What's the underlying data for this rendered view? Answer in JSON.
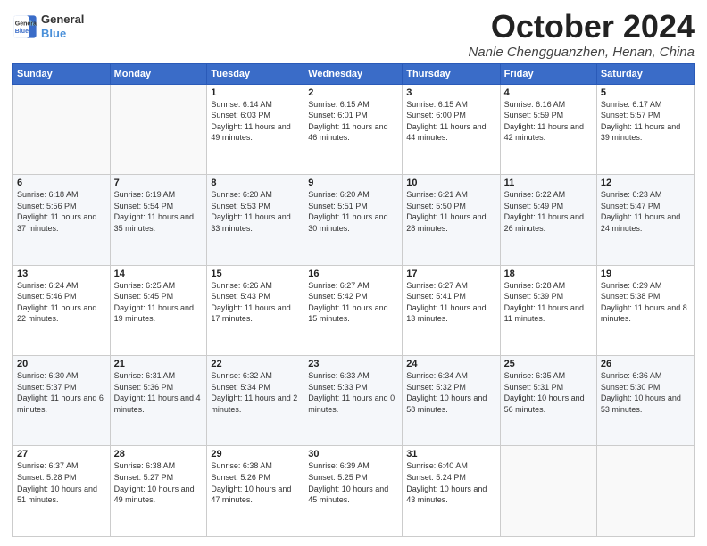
{
  "logo": {
    "line1": "General",
    "line2": "Blue"
  },
  "header": {
    "month": "October 2024",
    "location": "Nanle Chengguanzhen, Henan, China"
  },
  "weekdays": [
    "Sunday",
    "Monday",
    "Tuesday",
    "Wednesday",
    "Thursday",
    "Friday",
    "Saturday"
  ],
  "weeks": [
    [
      {
        "day": "",
        "info": ""
      },
      {
        "day": "",
        "info": ""
      },
      {
        "day": "1",
        "info": "Sunrise: 6:14 AM\nSunset: 6:03 PM\nDaylight: 11 hours and 49 minutes."
      },
      {
        "day": "2",
        "info": "Sunrise: 6:15 AM\nSunset: 6:01 PM\nDaylight: 11 hours and 46 minutes."
      },
      {
        "day": "3",
        "info": "Sunrise: 6:15 AM\nSunset: 6:00 PM\nDaylight: 11 hours and 44 minutes."
      },
      {
        "day": "4",
        "info": "Sunrise: 6:16 AM\nSunset: 5:59 PM\nDaylight: 11 hours and 42 minutes."
      },
      {
        "day": "5",
        "info": "Sunrise: 6:17 AM\nSunset: 5:57 PM\nDaylight: 11 hours and 39 minutes."
      }
    ],
    [
      {
        "day": "6",
        "info": "Sunrise: 6:18 AM\nSunset: 5:56 PM\nDaylight: 11 hours and 37 minutes."
      },
      {
        "day": "7",
        "info": "Sunrise: 6:19 AM\nSunset: 5:54 PM\nDaylight: 11 hours and 35 minutes."
      },
      {
        "day": "8",
        "info": "Sunrise: 6:20 AM\nSunset: 5:53 PM\nDaylight: 11 hours and 33 minutes."
      },
      {
        "day": "9",
        "info": "Sunrise: 6:20 AM\nSunset: 5:51 PM\nDaylight: 11 hours and 30 minutes."
      },
      {
        "day": "10",
        "info": "Sunrise: 6:21 AM\nSunset: 5:50 PM\nDaylight: 11 hours and 28 minutes."
      },
      {
        "day": "11",
        "info": "Sunrise: 6:22 AM\nSunset: 5:49 PM\nDaylight: 11 hours and 26 minutes."
      },
      {
        "day": "12",
        "info": "Sunrise: 6:23 AM\nSunset: 5:47 PM\nDaylight: 11 hours and 24 minutes."
      }
    ],
    [
      {
        "day": "13",
        "info": "Sunrise: 6:24 AM\nSunset: 5:46 PM\nDaylight: 11 hours and 22 minutes."
      },
      {
        "day": "14",
        "info": "Sunrise: 6:25 AM\nSunset: 5:45 PM\nDaylight: 11 hours and 19 minutes."
      },
      {
        "day": "15",
        "info": "Sunrise: 6:26 AM\nSunset: 5:43 PM\nDaylight: 11 hours and 17 minutes."
      },
      {
        "day": "16",
        "info": "Sunrise: 6:27 AM\nSunset: 5:42 PM\nDaylight: 11 hours and 15 minutes."
      },
      {
        "day": "17",
        "info": "Sunrise: 6:27 AM\nSunset: 5:41 PM\nDaylight: 11 hours and 13 minutes."
      },
      {
        "day": "18",
        "info": "Sunrise: 6:28 AM\nSunset: 5:39 PM\nDaylight: 11 hours and 11 minutes."
      },
      {
        "day": "19",
        "info": "Sunrise: 6:29 AM\nSunset: 5:38 PM\nDaylight: 11 hours and 8 minutes."
      }
    ],
    [
      {
        "day": "20",
        "info": "Sunrise: 6:30 AM\nSunset: 5:37 PM\nDaylight: 11 hours and 6 minutes."
      },
      {
        "day": "21",
        "info": "Sunrise: 6:31 AM\nSunset: 5:36 PM\nDaylight: 11 hours and 4 minutes."
      },
      {
        "day": "22",
        "info": "Sunrise: 6:32 AM\nSunset: 5:34 PM\nDaylight: 11 hours and 2 minutes."
      },
      {
        "day": "23",
        "info": "Sunrise: 6:33 AM\nSunset: 5:33 PM\nDaylight: 11 hours and 0 minutes."
      },
      {
        "day": "24",
        "info": "Sunrise: 6:34 AM\nSunset: 5:32 PM\nDaylight: 10 hours and 58 minutes."
      },
      {
        "day": "25",
        "info": "Sunrise: 6:35 AM\nSunset: 5:31 PM\nDaylight: 10 hours and 56 minutes."
      },
      {
        "day": "26",
        "info": "Sunrise: 6:36 AM\nSunset: 5:30 PM\nDaylight: 10 hours and 53 minutes."
      }
    ],
    [
      {
        "day": "27",
        "info": "Sunrise: 6:37 AM\nSunset: 5:28 PM\nDaylight: 10 hours and 51 minutes."
      },
      {
        "day": "28",
        "info": "Sunrise: 6:38 AM\nSunset: 5:27 PM\nDaylight: 10 hours and 49 minutes."
      },
      {
        "day": "29",
        "info": "Sunrise: 6:38 AM\nSunset: 5:26 PM\nDaylight: 10 hours and 47 minutes."
      },
      {
        "day": "30",
        "info": "Sunrise: 6:39 AM\nSunset: 5:25 PM\nDaylight: 10 hours and 45 minutes."
      },
      {
        "day": "31",
        "info": "Sunrise: 6:40 AM\nSunset: 5:24 PM\nDaylight: 10 hours and 43 minutes."
      },
      {
        "day": "",
        "info": ""
      },
      {
        "day": "",
        "info": ""
      }
    ]
  ]
}
